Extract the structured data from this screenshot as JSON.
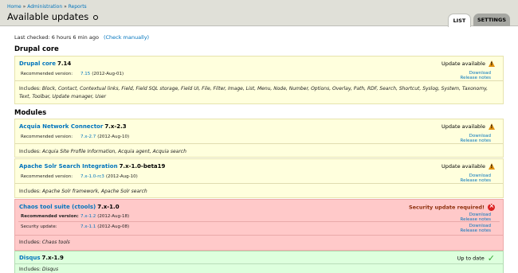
{
  "breadcrumb": {
    "home": "Home",
    "admin": "Administration",
    "reports": "Reports",
    "sep": "»"
  },
  "page_title": "Available updates",
  "tabs": {
    "list": "LIST",
    "settings": "SETTINGS"
  },
  "last_checked": {
    "text": "Last checked: 6 hours 6 min ago",
    "check_link": "(Check manually)"
  },
  "sections": {
    "core": "Drupal core",
    "modules": "Modules"
  },
  "labels": {
    "recommended": "Recommended version:",
    "security": "Security update:",
    "download": "Download",
    "release_notes": "Release notes",
    "includes": "Includes:"
  },
  "projects": [
    {
      "name": "Drupal core",
      "version": "7.14",
      "status": "Update available",
      "recommended_version": "7.15",
      "recommended_date": "(2012-Aug-01)",
      "includes": "Block, Contact, Contextual links, Field, Field SQL storage, Field UI, File, Filter, Image, List, Menu, Node, Number, Options, Overlay, Path, RDF, Search, Shortcut, Syslog, System, Taxonomy, Text, Toolbar, Update manager, User"
    },
    {
      "name": "Acquia Network Connector",
      "version": "7.x-2.3",
      "status": "Update available",
      "recommended_version": "7.x-2.7",
      "recommended_date": "(2012-Aug-10)",
      "includes": "Acquia Site Profile Information, Acquia agent, Acquia search"
    },
    {
      "name": "Apache Solr Search Integration",
      "version": "7.x-1.0-beta19",
      "status": "Update available",
      "recommended_version": "7.x-1.0-rc3",
      "recommended_date": "(2012-Aug-10)",
      "includes": "Apache Solr framework, Apache Solr search"
    },
    {
      "name": "Chaos tool suite (ctools)",
      "version": "7.x-1.0",
      "status": "Security update required!",
      "recommended_version": "7.x-1.2",
      "recommended_date": "(2012-Aug-18)",
      "security_version": "7.x-1.1",
      "security_date": "(2012-Aug-08)",
      "includes": "Chaos tools"
    },
    {
      "name": "Disqus",
      "version": "7.x-1.9",
      "status": "Up to date",
      "includes": "Disqus"
    }
  ]
}
